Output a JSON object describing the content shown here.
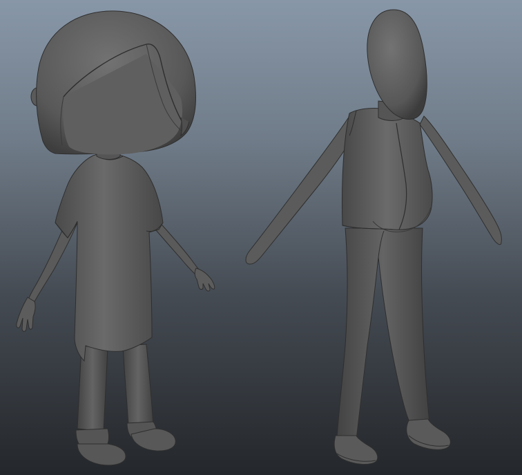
{
  "viewport": {
    "background_top": "#8897a8",
    "background_bottom": "#24272b",
    "model_color": "#5d5d5d",
    "model_highlight": "#7a7a7a",
    "model_shadow": "#3a3a3a",
    "edge_color": "#2c2c2c"
  },
  "models": [
    {
      "id": "girl-character",
      "description_hidden": true
    },
    {
      "id": "man-character",
      "description_hidden": true
    }
  ]
}
